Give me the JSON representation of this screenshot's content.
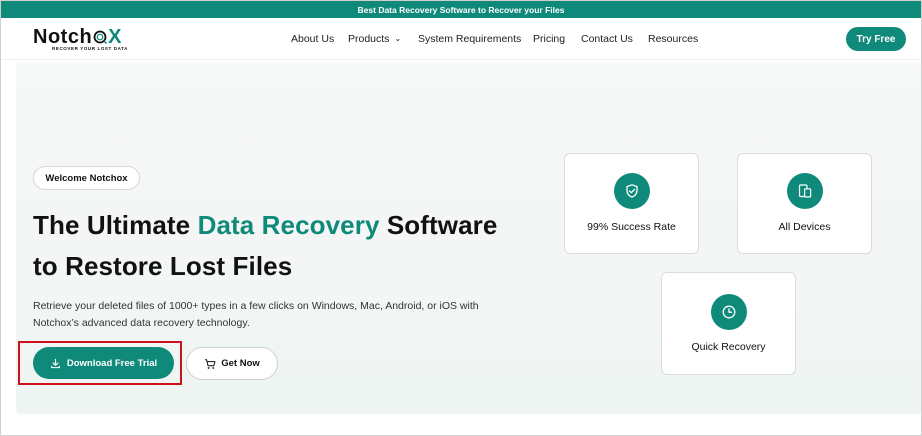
{
  "announcement": "Best Data Recovery Software to Recover your Files",
  "logo": {
    "word_left": "Notch",
    "word_right": "X",
    "tagline": "RECOVER YOUR LOST DATA"
  },
  "nav": {
    "items": [
      {
        "label": "About Us"
      },
      {
        "label": "Products",
        "has_dropdown": true
      },
      {
        "label": "System Requirements"
      },
      {
        "label": "Pricing"
      },
      {
        "label": "Contact Us"
      },
      {
        "label": "Resources"
      }
    ],
    "cta": "Try Free"
  },
  "hero": {
    "badge": "Welcome Notchox",
    "title_part1": "The Ultimate ",
    "title_accent": "Data Recovery",
    "title_part2": " Software",
    "title_line2": "to Restore Lost Files",
    "description_line1": "Retrieve your deleted files of 1000+ types in a few clicks on Windows, Mac, Android, or iOS with",
    "description_line2": "Notchox’s advanced data recovery technology.",
    "primary_button": "Download Free Trial",
    "secondary_button": "Get Now"
  },
  "features": [
    {
      "label": "99% Success Rate",
      "icon": "shield-check-icon"
    },
    {
      "label": "All Devices",
      "icon": "devices-icon"
    },
    {
      "label": "Quick Recovery",
      "icon": "clock-icon"
    }
  ],
  "colors": {
    "brand": "#0f8a7a",
    "highlight": "#d0111b"
  }
}
